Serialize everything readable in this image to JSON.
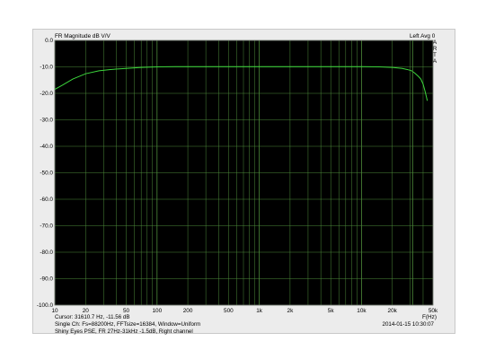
{
  "window": {
    "background": "#ececec",
    "plot_background": "#000000",
    "grid_color": "#4d8a3a",
    "trace_color": "#3cd63c"
  },
  "header": {
    "title": "FR Magnitude dB V/V",
    "status": "Left  Avg 0",
    "brand": "ARTA"
  },
  "footer": {
    "cursor": "Cursor: 31610.7 Hz, -11.56 dB",
    "settings": "Single Ch: Fs=88200Hz, FFTsize=16384, Window=Uniform",
    "description": "Shiny Eyes PSE, FR 27Hz-31kHz -1.5dB, Right channel",
    "date": "2014-01-15",
    "time": "10:30:07",
    "date_time": "2014-01-15   10:30:07"
  },
  "chart_data": {
    "type": "line",
    "title": "FR Magnitude dB V/V",
    "xlabel": "F(Hz)",
    "ylabel": "",
    "x_scale": "log",
    "xlim": [
      10,
      50000
    ],
    "ylim": [
      -100,
      0
    ],
    "grid": true,
    "x_ticks": [
      10,
      20,
      50,
      100,
      200,
      500,
      1000,
      2000,
      5000,
      10000,
      20000,
      50000
    ],
    "x_tick_labels": [
      "10",
      "20",
      "50",
      "100",
      "200",
      "500",
      "1k",
      "2k",
      "5k",
      "10k",
      "20k",
      "50k"
    ],
    "y_ticks": [
      0,
      -10,
      -20,
      -30,
      -40,
      -50,
      -60,
      -70,
      -80,
      -90,
      -100
    ],
    "y_tick_labels": [
      "0.0",
      "-10.0",
      "-20.0",
      "-30.0",
      "-40.0",
      "-50.0",
      "-60.0",
      "-70.0",
      "-80.0",
      "-90.0",
      "-100.0"
    ],
    "markers": [
      {
        "x": 31610.7,
        "y": -11.56
      }
    ],
    "series": [
      {
        "x": [
          10,
          12,
          15,
          20,
          27,
          35,
          50,
          70,
          100,
          150,
          200,
          300,
          500,
          1000,
          2000,
          5000,
          10000,
          15000,
          20000,
          25000,
          28000,
          31000,
          33000,
          36000,
          38000,
          40000,
          42000,
          44000
        ],
        "y": [
          -18.5,
          -16.8,
          -14.6,
          -12.6,
          -11.5,
          -11.0,
          -10.6,
          -10.2,
          -10.0,
          -9.9,
          -9.9,
          -9.9,
          -9.9,
          -9.9,
          -9.9,
          -9.9,
          -9.9,
          -10.0,
          -10.2,
          -10.6,
          -11.0,
          -11.5,
          -12.3,
          -13.6,
          -14.6,
          -16.5,
          -19.5,
          -22.8
        ]
      }
    ]
  }
}
